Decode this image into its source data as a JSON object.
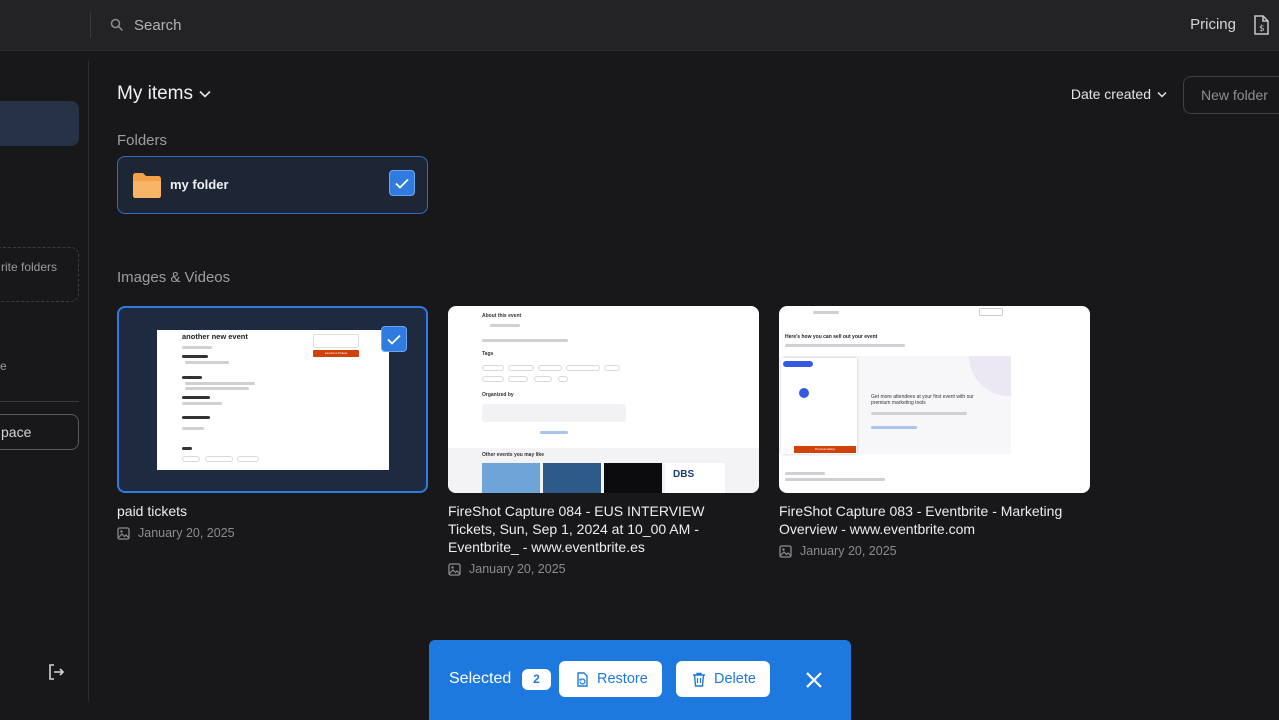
{
  "header": {
    "search_placeholder": "Search",
    "pricing_label": "Pricing",
    "file_icon": "file-dollar-icon"
  },
  "sidebar": {
    "favorites_label": "rite folders",
    "item_partial": "e",
    "space_button_label": "pace",
    "logout_icon": "logout-icon"
  },
  "main": {
    "title": "My items",
    "sort_label": "Date created",
    "new_folder_label": "New folder",
    "folders_heading": "Folders",
    "media_heading": "Images & Videos"
  },
  "folders": [
    {
      "name": "my folder",
      "selected": true,
      "color": "#f4a24a"
    }
  ],
  "items": [
    {
      "title": "paid tickets",
      "date": "January 20, 2025",
      "selected": true,
      "thumb_heading": "another new event",
      "thumb_button": "Launch a Tickets"
    },
    {
      "title": "FireShot Capture 084 - EUS INTERVIEW Tickets, Sun, Sep 1, 2024 at 10_00 AM - Eventbrite_ - www.eventbrite.es",
      "date": "January 20, 2025",
      "selected": false,
      "thumb_heading": "About this event",
      "thumb_section": "Tags",
      "thumb_section2": "Organized by",
      "thumb_footer": "Other events you may like",
      "thumb_logo": "DBS"
    },
    {
      "title": "FireShot Capture 083 - Eventbrite - Marketing Overview - www.eventbrite.com",
      "date": "January 20, 2025",
      "selected": false,
      "thumb_heading": "Here's how you can sell out your event",
      "thumb_promo": "Get more attendees at your first event with our premium marketing tools",
      "thumb_button": "Promote listing"
    }
  ],
  "selection_bar": {
    "label": "Selected",
    "count": "2",
    "restore_label": "Restore",
    "delete_label": "Delete",
    "accent": "#1e79df"
  }
}
